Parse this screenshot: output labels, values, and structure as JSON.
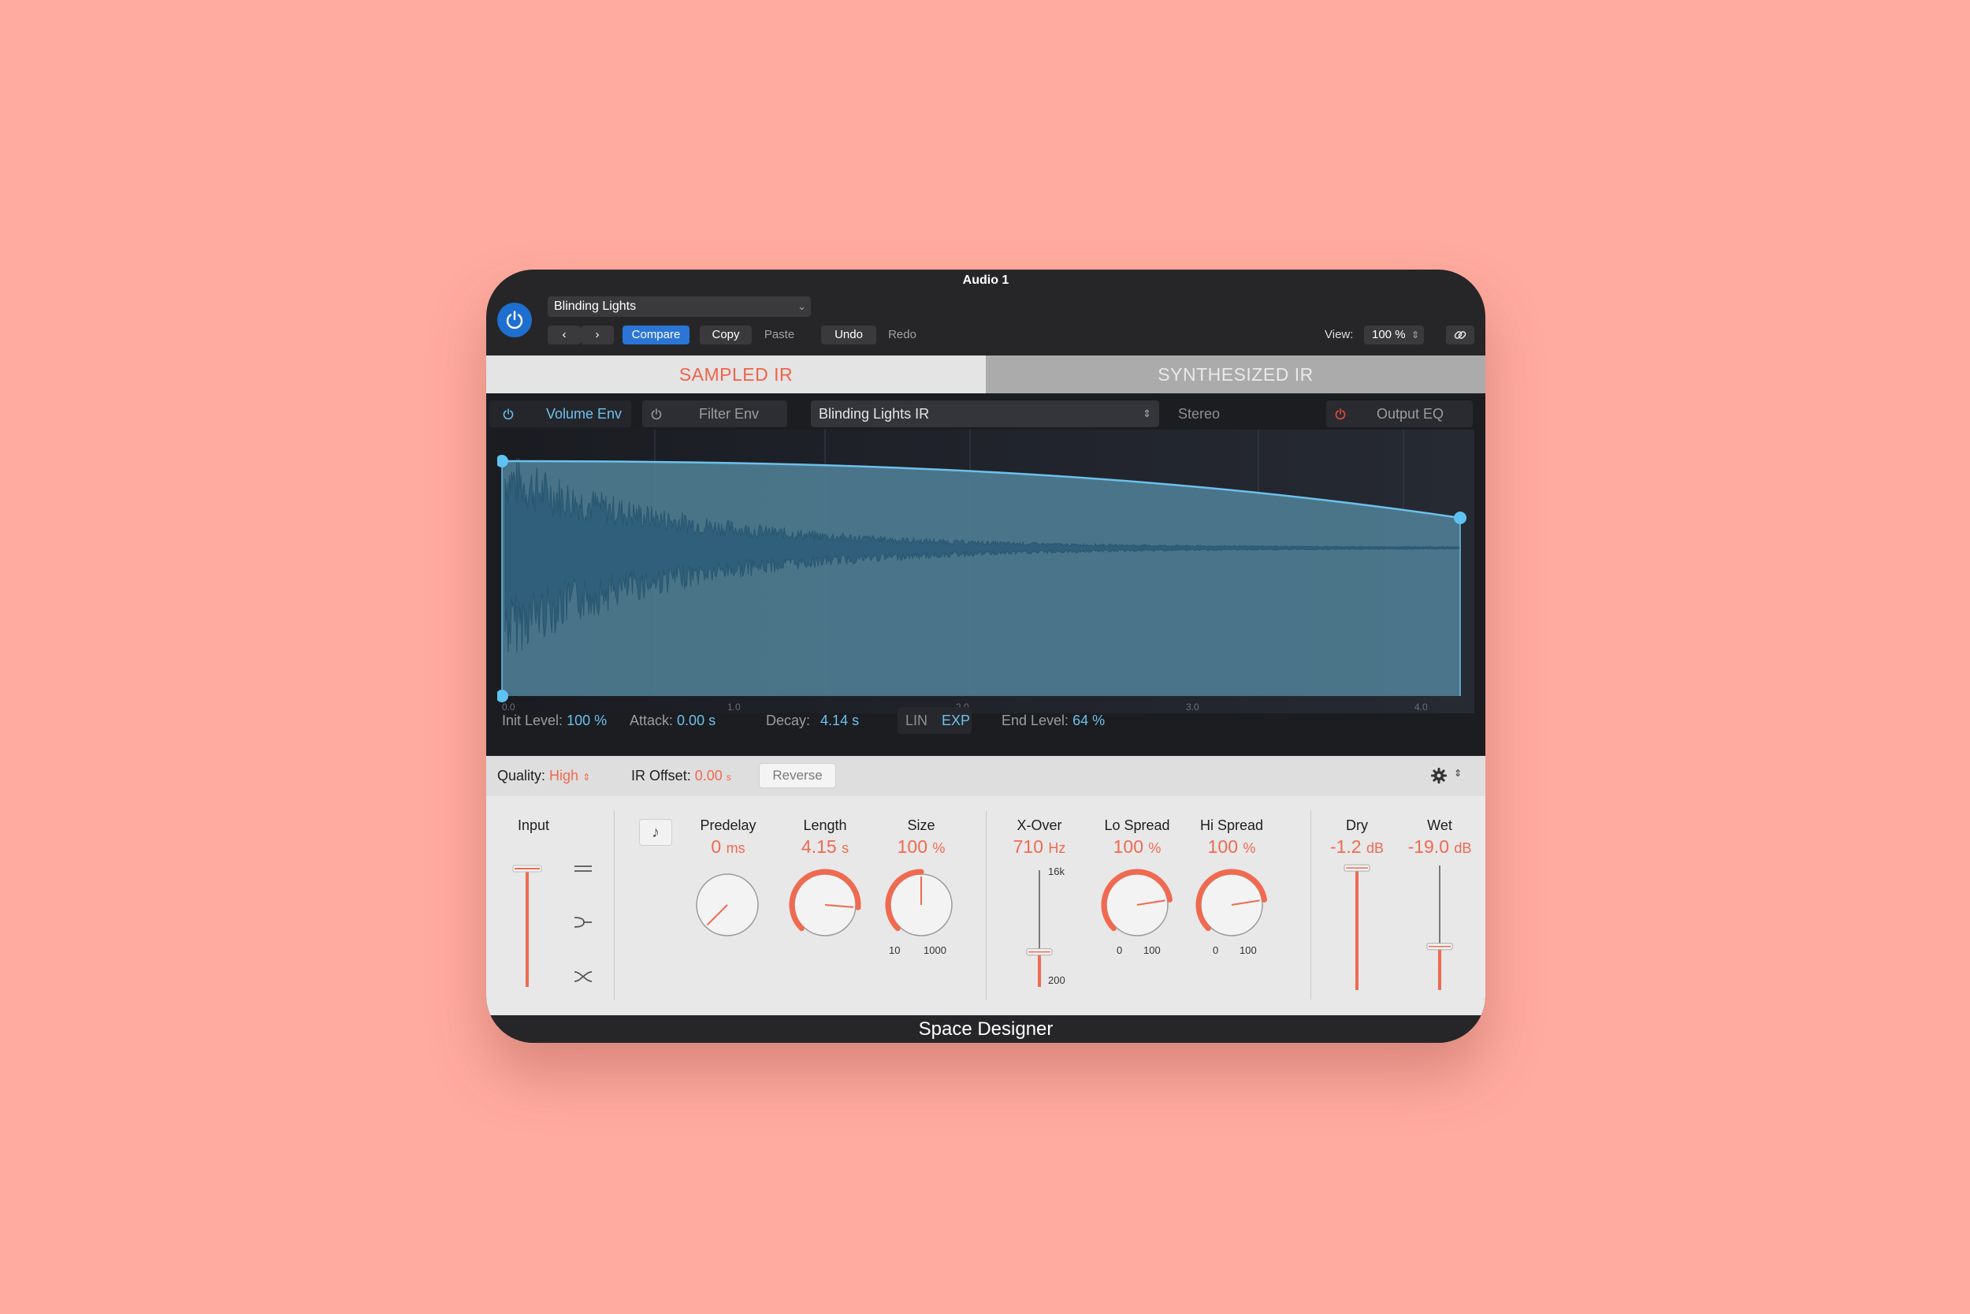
{
  "window": {
    "title": "Audio 1"
  },
  "header": {
    "preset": "Blinding Lights",
    "prev_label": "‹",
    "next_label": "›",
    "compare_label": "Compare",
    "copy_label": "Copy",
    "paste_label": "Paste",
    "undo_label": "Undo",
    "redo_label": "Redo",
    "view_label": "View:",
    "view_value": "100 %"
  },
  "mode_tabs": [
    {
      "label": "SAMPLED IR",
      "active": true
    },
    {
      "label": "SYNTHESIZED IR",
      "active": false
    }
  ],
  "env_toolbar": {
    "volume_env": "Volume Env",
    "filter_env": "Filter Env",
    "ir_file": "Blinding Lights IR",
    "channel_mode": "Stereo",
    "output_eq": "Output EQ"
  },
  "time_axis": [
    "0.0",
    "1.0",
    "2.0",
    "3.0",
    "4.0"
  ],
  "envelope": {
    "init_level_label": "Init Level:",
    "init_level_value": "100 %",
    "attack_label": "Attack:",
    "attack_value": "0.00 s",
    "decay_label": "Decay:",
    "decay_value": "4.14 s",
    "lin_label": "LIN",
    "exp_label": "EXP",
    "end_level_label": "End Level:",
    "end_level_value": "64 %"
  },
  "quality_bar": {
    "quality_label": "Quality:",
    "quality_value": "High",
    "ir_offset_label": "IR Offset:",
    "ir_offset_value": "0.00",
    "ir_offset_unit": "s",
    "reverse_label": "Reverse"
  },
  "controls": {
    "input_label": "Input",
    "predelay": {
      "label": "Predelay",
      "value": "0",
      "unit": "ms",
      "position": 0.0
    },
    "length": {
      "label": "Length",
      "value": "4.15",
      "unit": "s",
      "position": 0.85
    },
    "size": {
      "label": "Size",
      "value": "100",
      "unit": "%",
      "position": 0.5,
      "min": "10",
      "max": "1000"
    },
    "xover": {
      "label": "X-Over",
      "value": "710",
      "unit": "Hz",
      "top": "16k",
      "bottom": "200",
      "position": 0.3
    },
    "lo_spread": {
      "label": "Lo Spread",
      "value": "100",
      "unit": "%",
      "position": 0.8,
      "min": "0",
      "max": "100"
    },
    "hi_spread": {
      "label": "Hi Spread",
      "value": "100",
      "unit": "%",
      "position": 0.8,
      "min": "0",
      "max": "100"
    },
    "dry": {
      "label": "Dry",
      "value": "-1.2",
      "unit": "dB",
      "position": 0.98
    },
    "wet": {
      "label": "Wet",
      "value": "-19.0",
      "unit": "dB",
      "position": 0.35
    }
  },
  "footer": {
    "title": "Space Designer"
  },
  "colors": {
    "accent": "#ef6a50",
    "blue": "#6cc0ec",
    "power": "#1f6fd1"
  }
}
